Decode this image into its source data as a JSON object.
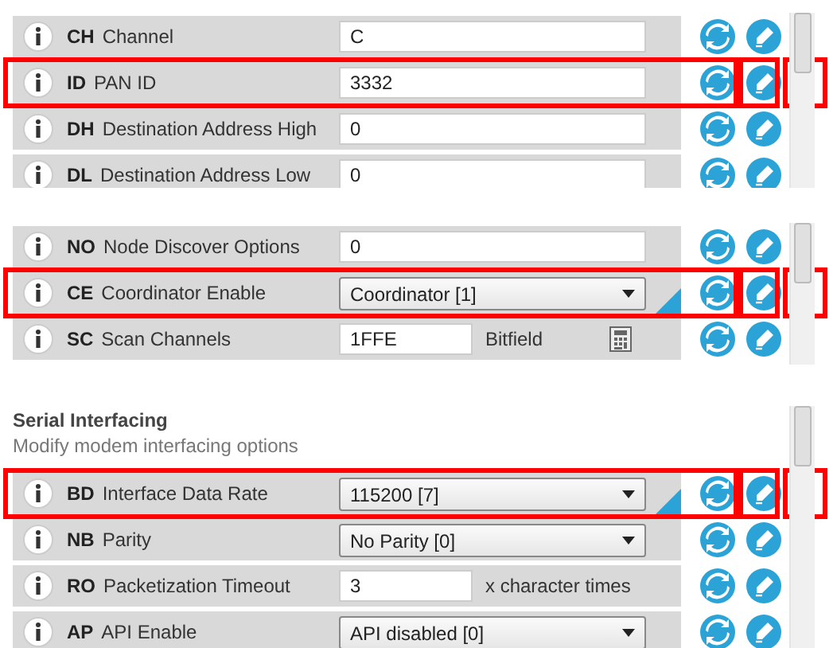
{
  "panels": [
    {
      "rows": [
        {
          "code": "CH",
          "name": "Channel",
          "kind": "text",
          "value": "C",
          "modified": false,
          "highlighted": false
        },
        {
          "code": "ID",
          "name": "PAN ID",
          "kind": "text",
          "value": "3332",
          "modified": false,
          "highlighted": true
        },
        {
          "code": "DH",
          "name": "Destination Address High",
          "kind": "text",
          "value": "0",
          "modified": false,
          "highlighted": false
        },
        {
          "code": "DL",
          "name": "Destination Address Low",
          "kind": "text",
          "value": "0",
          "modified": false,
          "highlighted": false
        }
      ]
    },
    {
      "rows": [
        {
          "code": "NO",
          "name": "Node Discover Options",
          "kind": "text",
          "value": "0",
          "modified": false,
          "highlighted": false
        },
        {
          "code": "CE",
          "name": "Coordinator Enable",
          "kind": "select",
          "value": "Coordinator [1]",
          "modified": true,
          "highlighted": true
        },
        {
          "code": "SC",
          "name": "Scan Channels",
          "kind": "bitfield",
          "value": "1FFE",
          "unit": "Bitfield",
          "modified": false,
          "highlighted": false
        }
      ]
    },
    {
      "title": "Serial Interfacing",
      "subtitle": "Modify modem interfacing options",
      "rows": [
        {
          "code": "BD",
          "name": "Interface Data Rate",
          "kind": "select",
          "value": "115200 [7]",
          "modified": true,
          "highlighted": true
        },
        {
          "code": "NB",
          "name": "Parity",
          "kind": "select",
          "value": "No Parity [0]",
          "modified": false,
          "highlighted": false
        },
        {
          "code": "RO",
          "name": "Packetization Timeout",
          "kind": "text",
          "value": "3",
          "unit": "x character times",
          "modified": false,
          "highlighted": false
        },
        {
          "code": "AP",
          "name": "API Enable",
          "kind": "select",
          "value": "API disabled [0]",
          "modified": false,
          "highlighted": false
        }
      ]
    }
  ]
}
